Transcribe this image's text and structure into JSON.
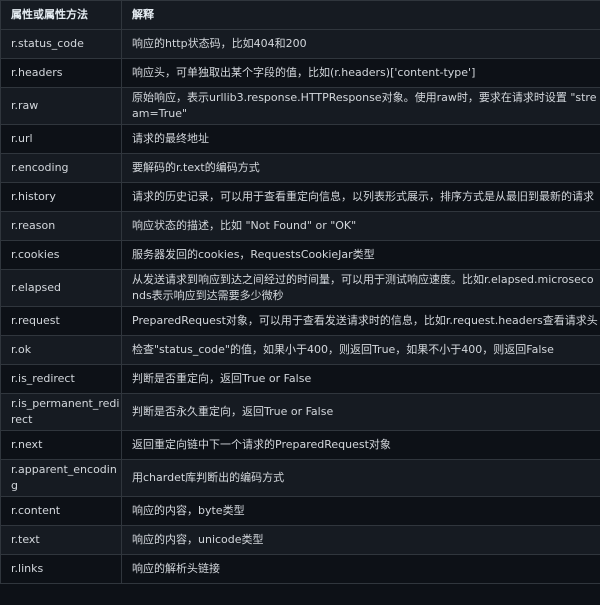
{
  "header": {
    "col1": "属性或属性方法",
    "col2": "解释"
  },
  "rows": [
    {
      "attr": "r.status_code",
      "desc": "响应的http状态码，比如404和200"
    },
    {
      "attr": "r.headers",
      "desc": "响应头，可单独取出某个字段的值，比如(r.headers)['content-type']"
    },
    {
      "attr": "r.raw",
      "desc": "原始响应，表示urllib3.response.HTTPResponse对象。使用raw时，要求在请求时设置 \"stream=True\""
    },
    {
      "attr": "r.url",
      "desc": "请求的最终地址"
    },
    {
      "attr": "r.encoding",
      "desc": "要解码的r.text的编码方式"
    },
    {
      "attr": "r.history",
      "desc": "请求的历史记录，可以用于查看重定向信息，以列表形式展示，排序方式是从最旧到最新的请求"
    },
    {
      "attr": "r.reason",
      "desc": "响应状态的描述，比如 \"Not Found\" or \"OK\""
    },
    {
      "attr": "r.cookies",
      "desc": "服务器发回的cookies，RequestsCookieJar类型"
    },
    {
      "attr": "r.elapsed",
      "desc": "从发送请求到响应到达之间经过的时间量，可以用于测试响应速度。比如r.elapsed.microseconds表示响应到达需要多少微秒"
    },
    {
      "attr": "r.request",
      "desc": "PreparedRequest对象，可以用于查看发送请求时的信息，比如r.request.headers查看请求头"
    },
    {
      "attr": "r.ok",
      "desc": "检查\"status_code\"的值，如果小于400，则返回True，如果不小于400，则返回False"
    },
    {
      "attr": "r.is_redirect",
      "desc": "判断是否重定向，返回True or False"
    },
    {
      "attr": "r.is_permanent_redirect",
      "desc": "判断是否永久重定向，返回True or False"
    },
    {
      "attr": "r.next",
      "desc": "返回重定向链中下一个请求的PreparedRequest对象"
    },
    {
      "attr": "r.apparent_encoding",
      "desc": "用chardet库判断出的编码方式"
    },
    {
      "attr": "r.content",
      "desc": "响应的内容，byte类型"
    },
    {
      "attr": "r.text",
      "desc": "响应的内容，unicode类型"
    },
    {
      "attr": "r.links",
      "desc": "响应的解析头链接"
    }
  ]
}
